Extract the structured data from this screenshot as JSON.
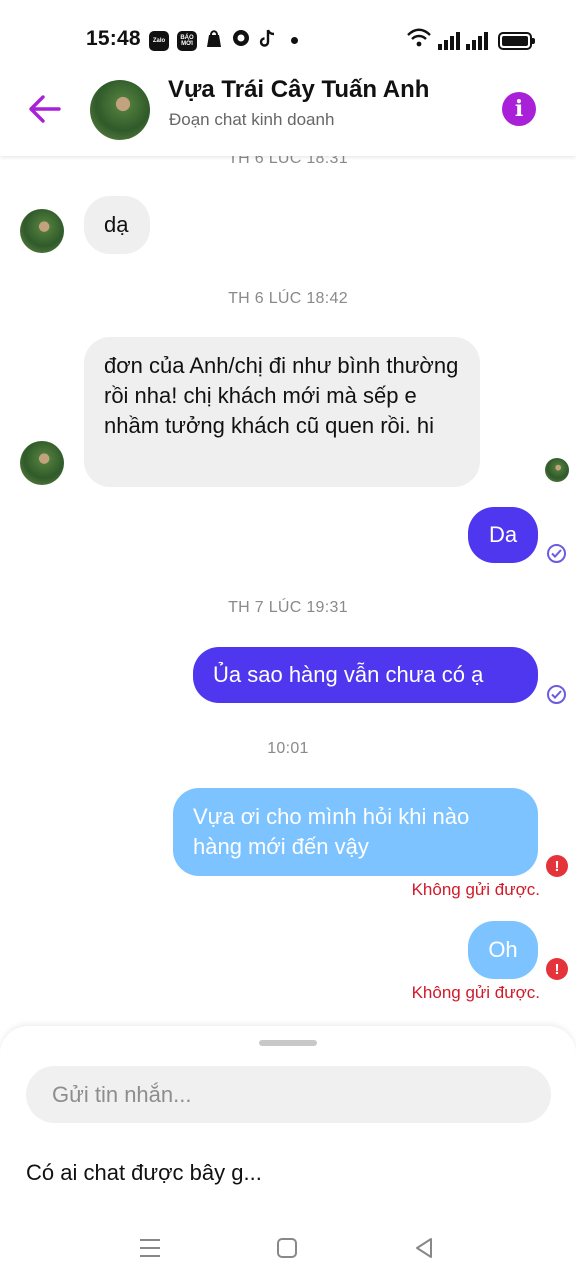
{
  "status_bar": {
    "time": "15:48",
    "app_icons": [
      "zalo-icon",
      "baomoi-icon",
      "bag-icon",
      "bubble-app-icon",
      "tiktok-icon"
    ],
    "app_icon_labels": {
      "zalo": "Zalo",
      "baomoi": "BÁO MỚI"
    },
    "battery_level": 1.0
  },
  "header": {
    "title": "Vựa Trái Cây Tuấn Anh",
    "subtitle": "Đoạn chat kinh doanh",
    "accent_color": "#a820d8"
  },
  "messages": {
    "timestamps": [
      "TH 6 LÚC 18:31",
      "TH 6 LÚC 18:42",
      "TH 7 LÚC 19:31",
      "10:01"
    ],
    "incoming": [
      {
        "text": "dạ"
      },
      {
        "text": "đơn của Anh/chị đi như bình thường rồi nha! chị khách mới mà sếp e nhầm tưởng khách cũ quen rồi. hi"
      }
    ],
    "outgoing": [
      {
        "text": "Da",
        "status": "seen"
      },
      {
        "text": "Ủa sao hàng vẫn chưa có ạ",
        "status": "sent"
      },
      {
        "text": "Vựa ơi cho mình hỏi khi nào hàng mới đến vậy",
        "status": "failed",
        "status_text": "Không gửi được."
      },
      {
        "text": "Oh",
        "status": "failed",
        "status_text": "Không gửi được."
      }
    ],
    "colors": {
      "sent": "#4f37f0",
      "failed": "#7cc3ff",
      "error": "#e5333c"
    }
  },
  "composer": {
    "placeholder": "Gửi tin nhắn...",
    "suggestion": "Có ai chat được bây g..."
  },
  "navbar": {
    "icons": [
      "menu-icon",
      "home-icon",
      "back-triangle-icon"
    ]
  }
}
